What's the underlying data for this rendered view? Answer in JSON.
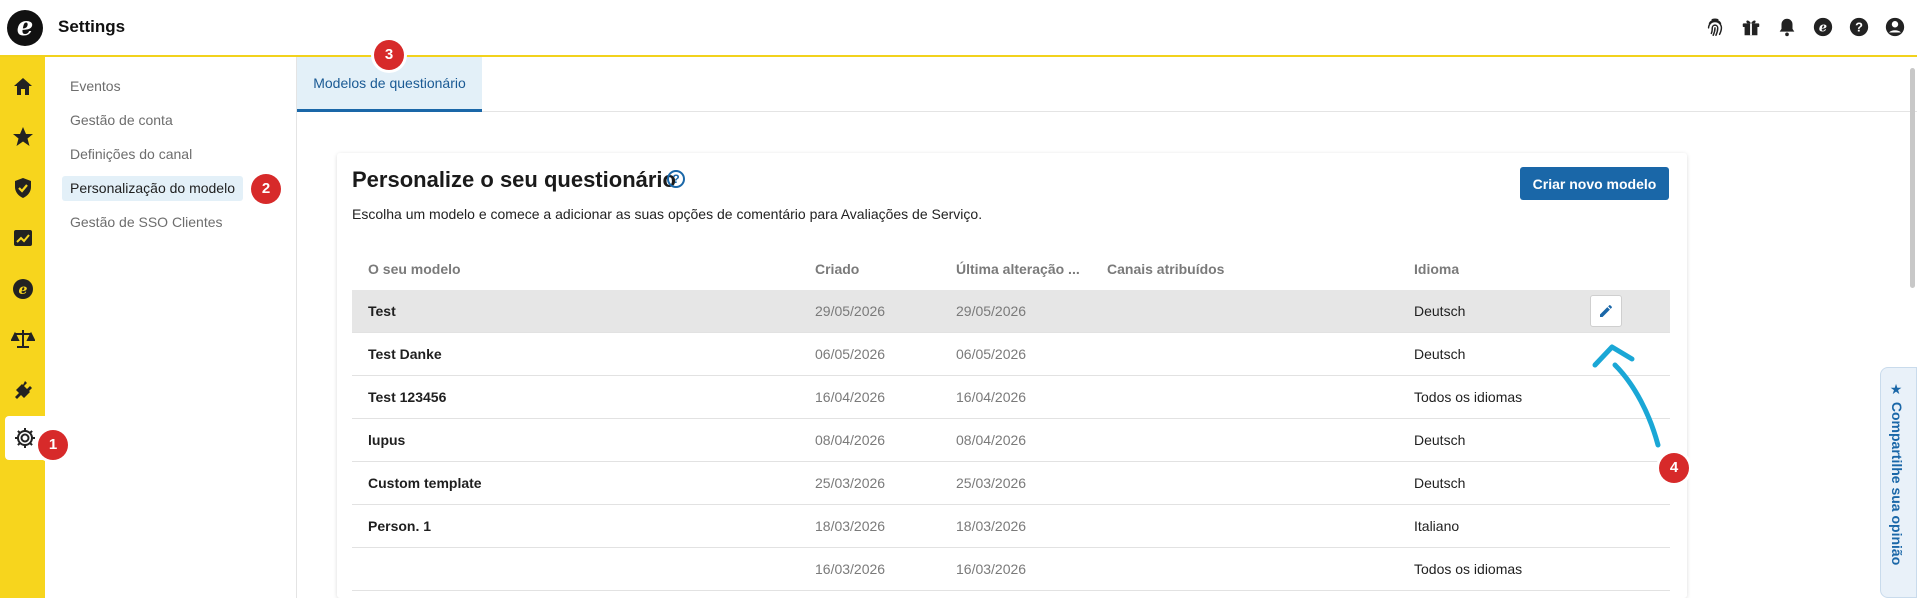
{
  "app": {
    "logo_letter": "e",
    "title": "Settings"
  },
  "top_icons": [
    "fingerprint-icon",
    "gift-icon",
    "bell-icon",
    "brand-e-icon",
    "help-icon",
    "user-icon"
  ],
  "brand_colors": {
    "accent_yellow": "#f7d51d",
    "primary_blue": "#1a67a8",
    "badge_red": "#d72a2a",
    "annotation_cyan": "#1aa7d6"
  },
  "rail": {
    "items": [
      "home-icon",
      "star-icon",
      "shield-check-icon",
      "chart-icon",
      "coin-icon",
      "scales-icon",
      "plug-icon",
      "gear-icon"
    ],
    "active": "gear-icon"
  },
  "subnav": {
    "items": [
      {
        "label": "Eventos"
      },
      {
        "label": "Gestão de conta"
      },
      {
        "label": "Definições do canal"
      },
      {
        "label": "Personalização do modelo",
        "active": true
      },
      {
        "label": "Gestão de SSO Clientes"
      }
    ]
  },
  "badges": [
    "1",
    "2",
    "3",
    "4"
  ],
  "tabs": [
    {
      "label": "Modelos de questionário",
      "active": true
    }
  ],
  "card": {
    "title": "Personalize o seu questionário",
    "help": "?",
    "subtitle": "Escolha um modelo e comece a adicionar as suas opções de comentário para Avaliações de Serviço.",
    "create_button": "Criar novo modelo",
    "columns": {
      "name": "O seu modelo",
      "created": "Criado",
      "changed": "Última alteração ...",
      "channels": "Canais atribuídos",
      "language": "Idioma"
    },
    "rows": [
      {
        "name": "Test",
        "created": "29/05/2026",
        "changed": "29/05/2026",
        "channels": "",
        "language": "Deutsch"
      },
      {
        "name": "Test Danke",
        "created": "06/05/2026",
        "changed": "06/05/2026",
        "channels": "",
        "language": "Deutsch"
      },
      {
        "name": "Test 123456",
        "created": "16/04/2026",
        "changed": "16/04/2026",
        "channels": "",
        "language": "Todos os idiomas"
      },
      {
        "name": "lupus",
        "created": "08/04/2026",
        "changed": "08/04/2026",
        "channels": "",
        "language": "Deutsch"
      },
      {
        "name": "Custom template",
        "created": "25/03/2026",
        "changed": "25/03/2026",
        "channels": "",
        "language": "Deutsch"
      },
      {
        "name": "Person. 1",
        "created": "18/03/2026",
        "changed": "18/03/2026",
        "channels": "",
        "language": "Italiano"
      },
      {
        "name": "",
        "created": "16/03/2026",
        "changed": "16/03/2026",
        "channels": "",
        "language": "Todos os idiomas"
      }
    ]
  },
  "feedback": {
    "label": "★ Compartilhe sua opinião"
  }
}
